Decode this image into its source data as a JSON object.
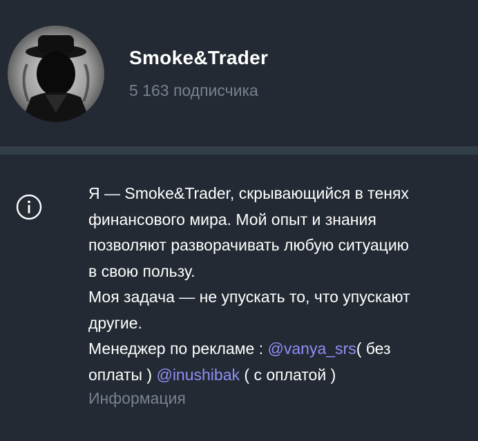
{
  "channel": {
    "name": "Smoke&Trader",
    "subscribers": "5 163 подписчика"
  },
  "info": {
    "icon": "info-icon",
    "lines": [
      "Я — Smoke&Trader, скрывающийся в тенях",
      "финансового мира. Мой опыт и знания",
      "позволяют разворачивать любую ситуацию",
      "в свою пользу.",
      "Моя задача — не упускать то, что упускают",
      "другие."
    ],
    "ads_line": {
      "prefix": "Менеджер по рекламе :  ",
      "mention1": "@vanya_srs",
      "suffix1": "( без"
    },
    "ads_line2": {
      "prefix": "оплаты ) ",
      "mention2": "@inushibak",
      "suffix2": " ( с оплатой )"
    },
    "label": "Информация"
  },
  "colors": {
    "background": "#232a33",
    "divider": "#323e48",
    "muted_text": "#76838f",
    "link": "#8f8ff5"
  }
}
